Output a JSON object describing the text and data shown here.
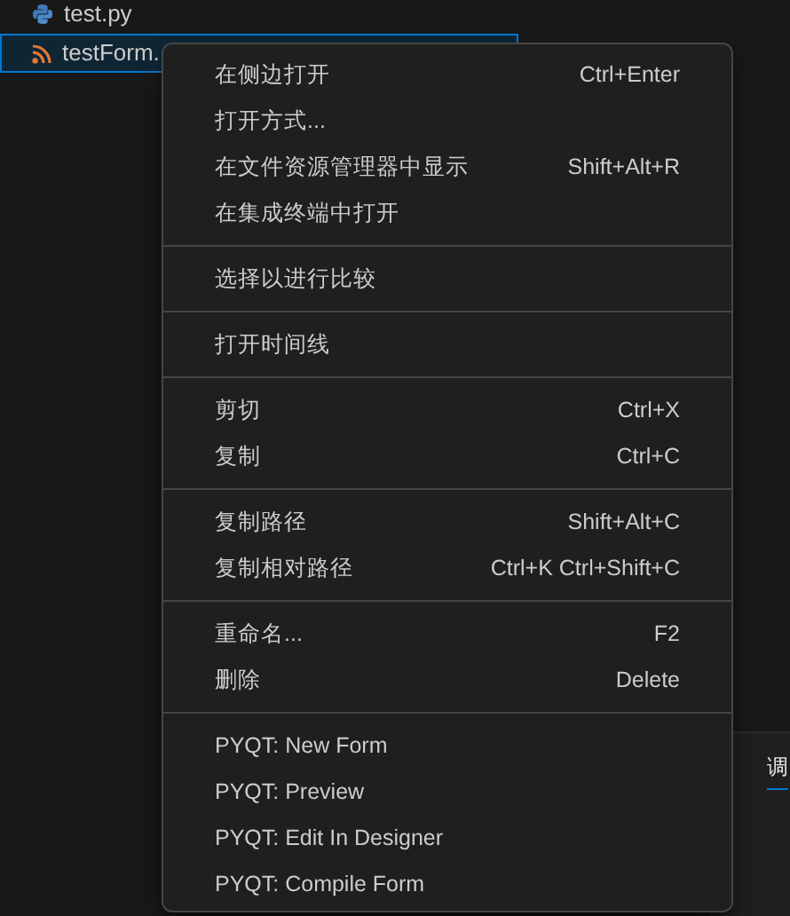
{
  "explorer": {
    "files": [
      {
        "name": "test.py",
        "kind": "python",
        "selected": false
      },
      {
        "name": "testForm.",
        "kind": "form",
        "selected": true
      }
    ]
  },
  "context_menu": {
    "groups": [
      [
        {
          "label": "在侧边打开",
          "shortcut": "Ctrl+Enter"
        },
        {
          "label": "打开方式..."
        },
        {
          "label": "在文件资源管理器中显示",
          "shortcut": "Shift+Alt+R"
        },
        {
          "label": "在集成终端中打开"
        }
      ],
      [
        {
          "label": "选择以进行比较"
        }
      ],
      [
        {
          "label": "打开时间线"
        }
      ],
      [
        {
          "label": "剪切",
          "shortcut": "Ctrl+X"
        },
        {
          "label": "复制",
          "shortcut": "Ctrl+C"
        }
      ],
      [
        {
          "label": "复制路径",
          "shortcut": "Shift+Alt+C"
        },
        {
          "label": "复制相对路径",
          "shortcut": "Ctrl+K Ctrl+Shift+C"
        }
      ],
      [
        {
          "label": "重命名...",
          "shortcut": "F2"
        },
        {
          "label": "删除",
          "shortcut": "Delete"
        }
      ],
      [
        {
          "label": "PYQT: New Form"
        },
        {
          "label": "PYQT: Preview"
        },
        {
          "label": "PYQT: Edit In Designer"
        },
        {
          "label": "PYQT: Compile Form"
        }
      ]
    ]
  },
  "panel": {
    "tabs": [
      {
        "label": "调",
        "selected": true
      }
    ]
  }
}
